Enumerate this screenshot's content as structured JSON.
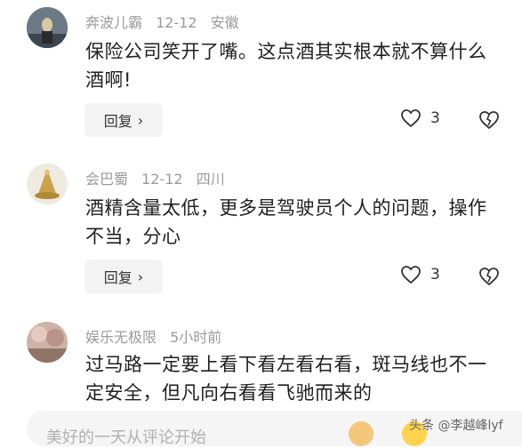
{
  "comments": [
    {
      "username": "奔波儿霸",
      "date": "12-12",
      "location": "安徽",
      "text": "保险公司笑开了嘴。这点酒其实根本就不算什么酒啊!",
      "reply_label": "回复",
      "likes": "3"
    },
    {
      "username": "会巴蜀",
      "date": "12-12",
      "location": "四川",
      "text": "酒精含量太低，更多是驾驶员个人的问题，操作不当，分心",
      "reply_label": "回复",
      "likes": "3"
    },
    {
      "username": "娱乐无极限",
      "date": "5小时前",
      "text": "过马路一定要上看下看左看右看，斑马线也不一定安全，但凡向右看看飞驰而来的"
    }
  ],
  "input": {
    "placeholder": "美好的一天从评论开始"
  },
  "watermark": "头条 @李越峰lyf",
  "icons": {
    "like": "heart-icon",
    "dislike": "broken-heart-icon",
    "reply_chevron": "chevron-right-icon"
  }
}
